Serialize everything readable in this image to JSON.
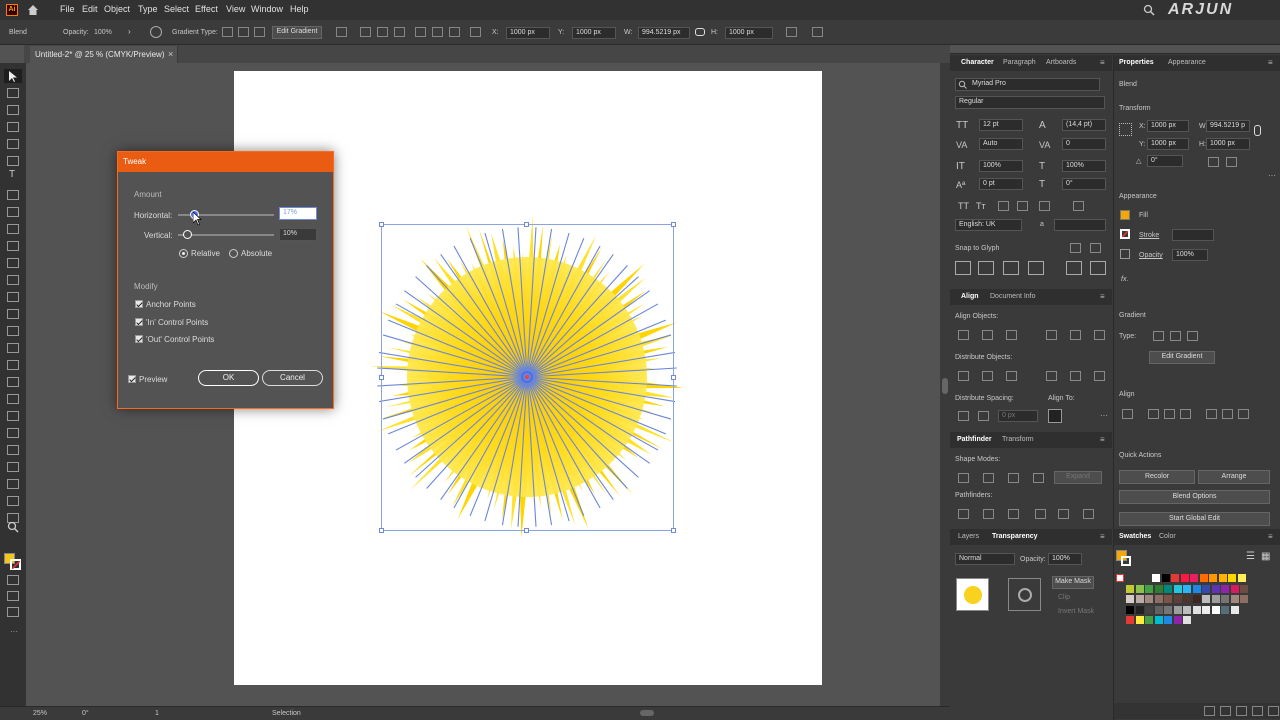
{
  "menubar": {
    "logo": "Ai",
    "items": [
      "File",
      "Edit",
      "Object",
      "Type",
      "Select",
      "Effect",
      "View",
      "Window",
      "Help"
    ],
    "watermark": "ARJUN"
  },
  "control": {
    "mode": "Blend",
    "opacity_label": "Opacity:",
    "opacity": "100%",
    "gradient_type_label": "Gradient Type:",
    "edit_gradient": "Edit Gradient",
    "x_label": "X:",
    "x": "1000 px",
    "y_label": "Y:",
    "y": "1000 px",
    "w_label": "W:",
    "w": "994.5219 px",
    "h_label": "H:",
    "h": "1000 px"
  },
  "document": {
    "tab": "Untitled-2* @ 25 % (CMYK/Preview)",
    "close": "×"
  },
  "status": {
    "zoom": "25%",
    "rotate": "0°",
    "artboard": "1",
    "tool": "Selection"
  },
  "tweak": {
    "title": "Tweak",
    "amount_label": "Amount",
    "horizontal_label": "Horizontal:",
    "horizontal_value": "17%",
    "horizontal_pct": 0.17,
    "vertical_label": "Vertical:",
    "vertical_value": "10%",
    "vertical_pct": 0.1,
    "relative": "Relative",
    "absolute": "Absolute",
    "modify_label": "Modify",
    "anchor": "Anchor Points",
    "in_points": "'In' Control Points",
    "out_points": "'Out' Control Points",
    "preview": "Preview",
    "ok": "OK",
    "cancel": "Cancel"
  },
  "character": {
    "tabs": [
      "Character",
      "Paragraph",
      "Artboards"
    ],
    "font": "Myriad Pro",
    "style": "Regular",
    "size": "12 pt",
    "leading": "(14,4 pt)",
    "kerning": "Auto",
    "tracking": "0",
    "vscale": "100%",
    "hscale": "100%",
    "baseline": "0 pt",
    "rotation": "0°",
    "tt1": "TT",
    "tt2": "Tт",
    "language": "English: UK",
    "aa": "a",
    "snap": "Snap to Glyph"
  },
  "align": {
    "tabs": [
      "Align",
      "Document Info"
    ],
    "align_objects": "Align Objects:",
    "distribute_objects": "Distribute Objects:",
    "distribute_spacing": "Distribute Spacing:",
    "align_to": "Align To:",
    "spacing_value": "0 px"
  },
  "pathfinder": {
    "tabs": [
      "Pathfinder",
      "Transform"
    ],
    "shape_modes": "Shape Modes:",
    "expand": "Expand",
    "pathfinders": "Pathfinders:"
  },
  "transparency": {
    "tabs": [
      "Layers",
      "Transparency"
    ],
    "mode": "Normal",
    "opacity_label": "Opacity:",
    "opacity": "100%",
    "make_mask": "Make Mask",
    "clip": "Clip",
    "invert": "Invert Mask"
  },
  "properties": {
    "tabs": [
      "Properties",
      "Appearance"
    ],
    "object": "Blend",
    "transform": "Transform",
    "x_label": "X:",
    "x": "1000 px",
    "y_label": "Y:",
    "y": "1000 px",
    "w_label": "W:",
    "w": "994.5219 p",
    "h_label": "H:",
    "h": "1000 px",
    "angle": "0°",
    "appearance": "Appearance",
    "fill": "Fill",
    "stroke": "Stroke",
    "opacity_label": "Opacity",
    "opacity": "100%",
    "fx": "fx.",
    "gradient": "Gradient",
    "type_label": "Type:",
    "edit_gradient": "Edit Gradient",
    "align": "Align",
    "quick_actions": "Quick Actions",
    "recolor": "Recolor",
    "arrange": "Arrange",
    "blend_options": "Blend Options",
    "global_edit": "Start Global Edit"
  },
  "swatches": {
    "tabs": [
      "Swatches",
      "Color"
    ],
    "row1": [
      "#ffffff",
      "#000000",
      "#e53935",
      "#ff1744",
      "#e91e63",
      "#ff6d00",
      "#ff9800",
      "#ffb300",
      "#ffd600",
      "#ffee58"
    ],
    "row2": [
      "#c0ca33",
      "#8bc34a",
      "#43a047",
      "#2e7d32",
      "#00897b",
      "#26c6da",
      "#29b6f6",
      "#1e88e5",
      "#3949ab",
      "#5e35b1",
      "#8e24aa",
      "#d81b60",
      "#6d4c41"
    ],
    "row3": [
      "#d7ccc8",
      "#bcaaa4",
      "#a1887f",
      "#8d6e63",
      "#795548",
      "#5d4037",
      "#4e342e",
      "#3e2723",
      "#bdbdbd",
      "#9e9e9e",
      "#757575",
      "#a1887f",
      "#8d6e63"
    ],
    "row4": [
      "#000000",
      "#212121",
      "#424242",
      "#616161",
      "#757575",
      "#9e9e9e",
      "#bdbdbd",
      "#e0e0e0",
      "#eeeeee",
      "#ffffff",
      "#546e7a",
      "#e8e8e8"
    ],
    "row5": [
      "#e53935",
      "#ffeb3b",
      "#43a047",
      "#00bcd4",
      "#1e88e5",
      "#8e24aa",
      "#e0e0e0"
    ]
  }
}
